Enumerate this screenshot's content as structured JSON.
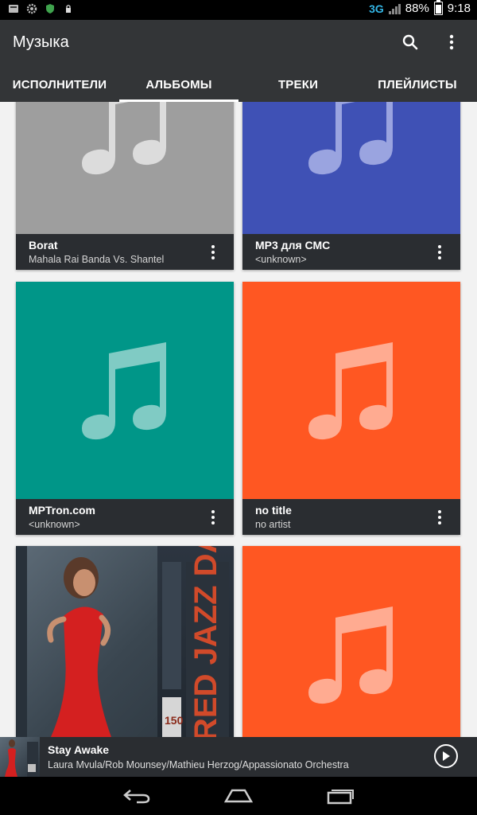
{
  "status_bar": {
    "network": "3G",
    "battery_percent": "88%",
    "battery_level": 0.88,
    "time": "9:18",
    "left_icons": [
      "inbox-icon",
      "gear-icon",
      "shield-icon",
      "lock-icon"
    ]
  },
  "app_bar": {
    "title": "Музыка",
    "actions": [
      "search-icon",
      "more-vert-icon"
    ]
  },
  "tabs": [
    {
      "label": "ИСПОЛНИТЕЛИ",
      "active": false
    },
    {
      "label": "АЛЬБОМЫ",
      "active": true
    },
    {
      "label": "ТРЕКИ",
      "active": false
    },
    {
      "label": "ПЛЕЙЛИСТЫ",
      "active": false
    }
  ],
  "albums": [
    {
      "title": "Borat",
      "artist": "Mahala Rai Banda Vs. Shantel",
      "art": "music-note-icon",
      "color": "#9e9e9e"
    },
    {
      "title": "MP3 для СМС",
      "artist": "<unknown>",
      "art": "music-note-icon",
      "color": "#3f51b5"
    },
    {
      "title": "MPTron.com",
      "artist": "<unknown>",
      "art": "music-note-icon",
      "color": "#009688"
    },
    {
      "title": "no title",
      "artist": "no artist",
      "art": "music-note-icon",
      "color": "#ff5722"
    },
    {
      "title": "",
      "artist": "",
      "art": "cover-photo",
      "color": "#4c5a66"
    },
    {
      "title": "",
      "artist": "",
      "art": "music-note-icon",
      "color": "#ff5722"
    }
  ],
  "now_playing": {
    "title": "Stay Awake",
    "artist": "Laura Mvula/Rob Mounsey/Mathieu Herzog/Appassionato Orchestra"
  },
  "nav_bar": [
    "back-icon",
    "home-icon",
    "recents-icon"
  ]
}
